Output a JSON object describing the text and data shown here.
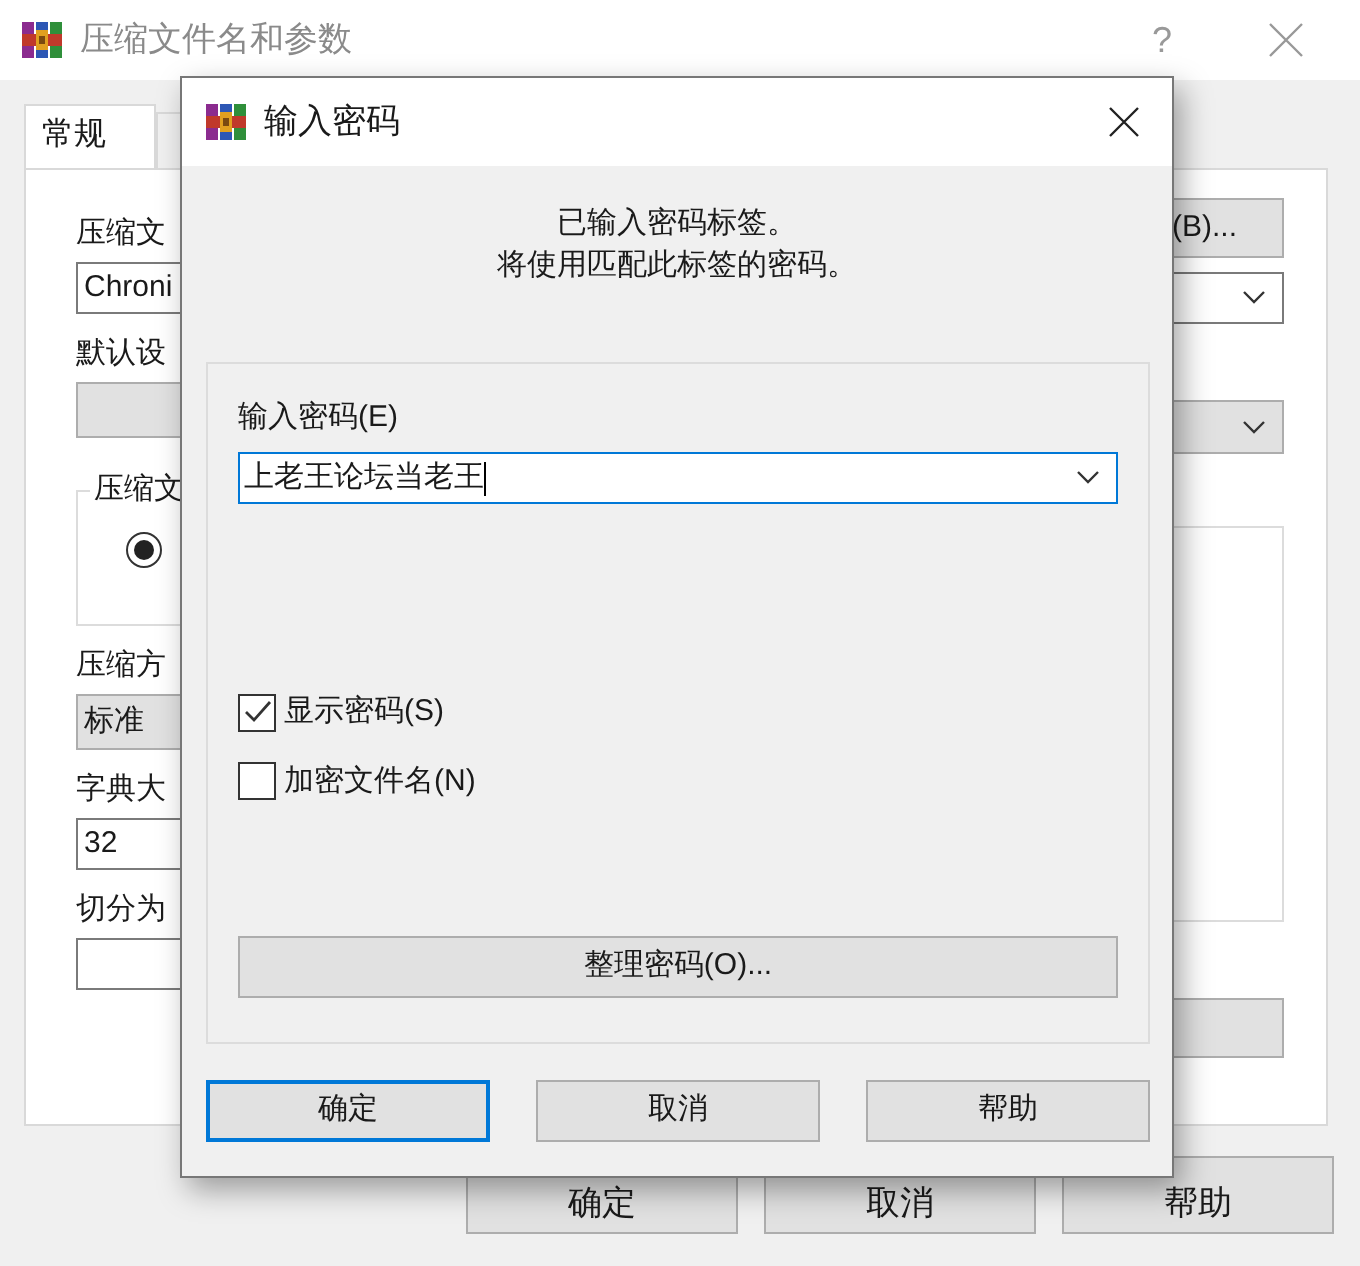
{
  "window": {
    "title": "压缩文件名和参数",
    "help": "?"
  },
  "tabs": [
    {
      "label": "常规",
      "selected": true
    },
    {
      "selected": false
    }
  ],
  "left_column": [
    {
      "kind": "label",
      "text": "压缩文"
    },
    {
      "kind": "field",
      "text": "Chroni"
    },
    {
      "kind": "label",
      "text": "默认设"
    },
    {
      "kind": "grey_field"
    },
    {
      "kind": "group",
      "text": "压缩文",
      "selected": true
    },
    {
      "kind": "label",
      "text": "压缩方"
    },
    {
      "kind": "grey_field",
      "text": "标准"
    },
    {
      "kind": "label",
      "text": "字典大"
    },
    {
      "kind": "field",
      "text": "32"
    },
    {
      "kind": "label",
      "text": "切分为"
    },
    {
      "kind": "field"
    }
  ],
  "right_column": [
    {
      "kind": "button",
      "text": "(B)..."
    },
    {
      "kind": "combo"
    },
    {
      "kind": "grey_combo"
    },
    {
      "kind": "list"
    },
    {
      "kind": "button"
    }
  ],
  "buttons": [
    "确定",
    "取消",
    "帮助"
  ],
  "dialog": {
    "title": "输入密码",
    "message": [
      "已输入密码标签。",
      "将使用匹配此标签的密码。"
    ],
    "password_label": "输入密码(E)",
    "password_value": "上老王论坛当老王",
    "checkboxes": [
      {
        "label": "显示密码(S)",
        "checked": true
      },
      {
        "label": "加密文件名(N)",
        "checked": false
      }
    ],
    "organize_button": "整理密码(O)...",
    "buttons": [
      {
        "label": "确定",
        "default": true
      },
      {
        "label": "取消",
        "default": false
      },
      {
        "label": "帮助",
        "default": false
      }
    ]
  }
}
